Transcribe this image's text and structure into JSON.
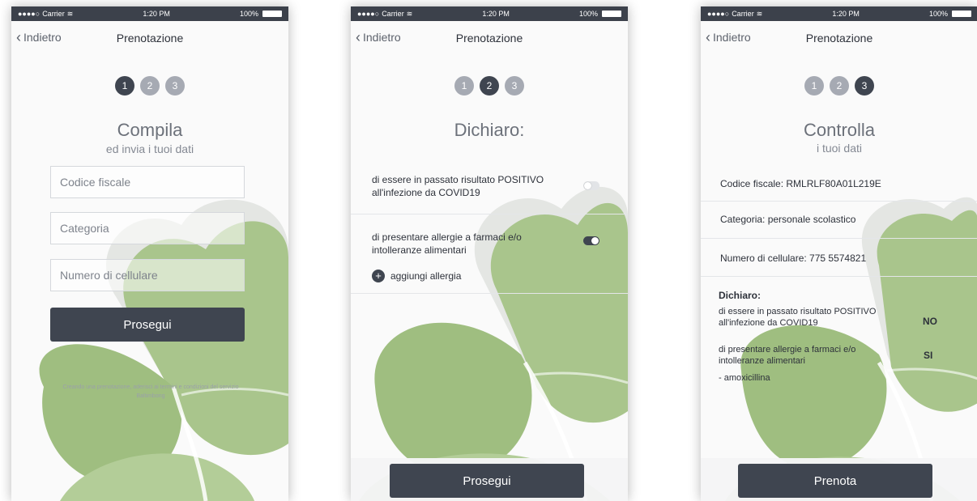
{
  "status_bar": {
    "carrier": "Carrier",
    "time": "1:20 PM",
    "battery": "100%"
  },
  "nav": {
    "back_label": "Indietro",
    "title": "Prenotazione"
  },
  "steps": [
    "1",
    "2",
    "3"
  ],
  "colors": {
    "dark": "#3f4550",
    "step_inactive": "#a6aab3",
    "clover": "#a9c58c"
  },
  "screen1": {
    "heading": "Compila",
    "subheading": "ed invia i tuoi dati",
    "fields": [
      {
        "placeholder": "Codice fiscale"
      },
      {
        "placeholder": "Categoria"
      },
      {
        "placeholder": "Numero di cellulare"
      }
    ],
    "button": "Prosegui",
    "terms": "Creando una prenotazione, aderisci ai termini e condizioni del servizio Baltimbong"
  },
  "screen2": {
    "heading": "Dichiaro:",
    "declarations": [
      {
        "text": "di essere in passato risultato POSITIVO all'infezione da COVID19",
        "enabled": false
      },
      {
        "text": "di presentare allergie a farmaci e/o intolleranze alimentari",
        "enabled": true
      }
    ],
    "add_allergy": "aggiungi allergia",
    "button": "Prosegui"
  },
  "screen3": {
    "heading": "Controlla",
    "subheading": "i tuoi dati",
    "codice": "Codice fiscale: RMLRLF80A01L219E",
    "categoria": "Categoria: personale scolastico",
    "cellulare": "Numero di cellulare: 775 5574821",
    "dichiaro_title": "Dichiaro:",
    "decl1": "di essere in passato risultato POSITIVO all'infezione da COVID19",
    "decl1_answer": "NO",
    "decl2": "di presentare allergie a farmaci e/o intolleranze alimentari",
    "decl2_answer": "SI",
    "allergy_item": "- amoxicillina",
    "button": "Prenota"
  }
}
